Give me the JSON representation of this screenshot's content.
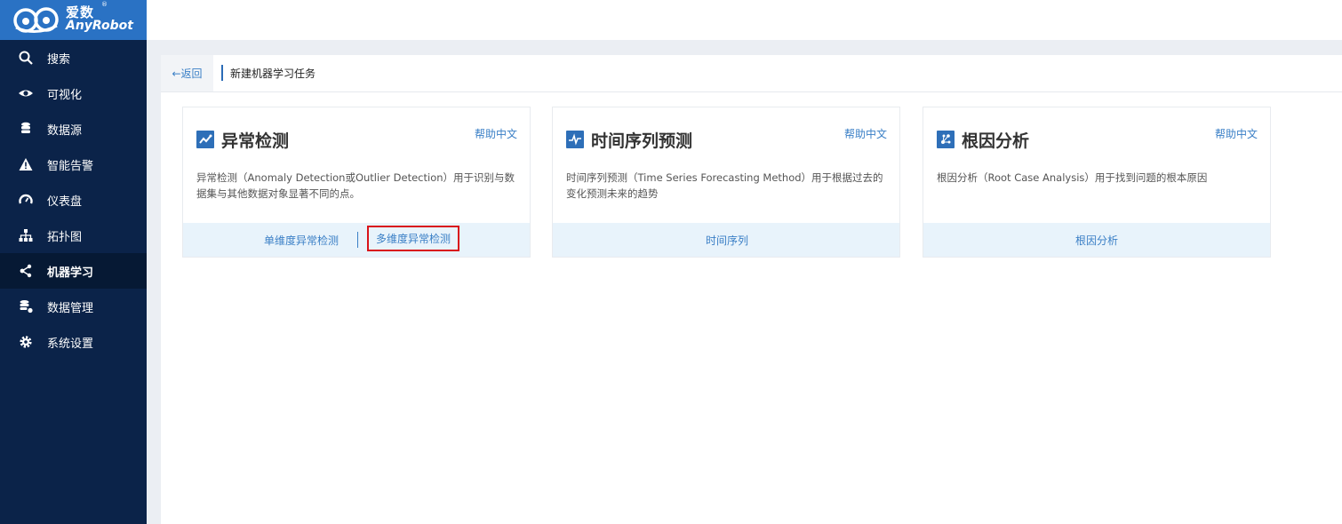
{
  "logo": {
    "brand_cn": "爱数",
    "brand_en": "AnyRobot",
    "reg": "®"
  },
  "sidebar": {
    "items": [
      {
        "label": "搜索",
        "icon": "search-icon"
      },
      {
        "label": "可视化",
        "icon": "eye-icon"
      },
      {
        "label": "数据源",
        "icon": "database-icon"
      },
      {
        "label": "智能告警",
        "icon": "warning-icon"
      },
      {
        "label": "仪表盘",
        "icon": "gauge-icon"
      },
      {
        "label": "拓扑图",
        "icon": "topology-icon"
      },
      {
        "label": "机器学习",
        "icon": "ml-icon",
        "active": true
      },
      {
        "label": "数据管理",
        "icon": "data-manage-icon"
      },
      {
        "label": "系统设置",
        "icon": "gear-icon"
      }
    ]
  },
  "breadcrumb": {
    "back_label": "←返回",
    "title": "新建机器学习任务"
  },
  "cards": [
    {
      "title": "异常检测",
      "help": "帮助中文",
      "description": "异常检测（Anomaly Detection或Outlier Detection）用于识别与数据集与其他数据对象显著不同的点。",
      "actions": [
        "单维度异常检测",
        "多维度异常检测"
      ]
    },
    {
      "title": "时间序列预测",
      "help": "帮助中文",
      "description": "时间序列预测（Time Series Forecasting Method）用于根据过去的变化预测未来的趋势",
      "actions": [
        "时间序列"
      ]
    },
    {
      "title": "根因分析",
      "help": "帮助中文",
      "description": "根因分析（Root Case Analysis）用于找到问题的根本原因",
      "actions": [
        "根因分析"
      ]
    }
  ],
  "colors": {
    "sidebar_bg": "#0b2349",
    "logo_bg": "#2a72c4",
    "accent": "#3a7fc6",
    "highlight_border": "#d9131a"
  }
}
